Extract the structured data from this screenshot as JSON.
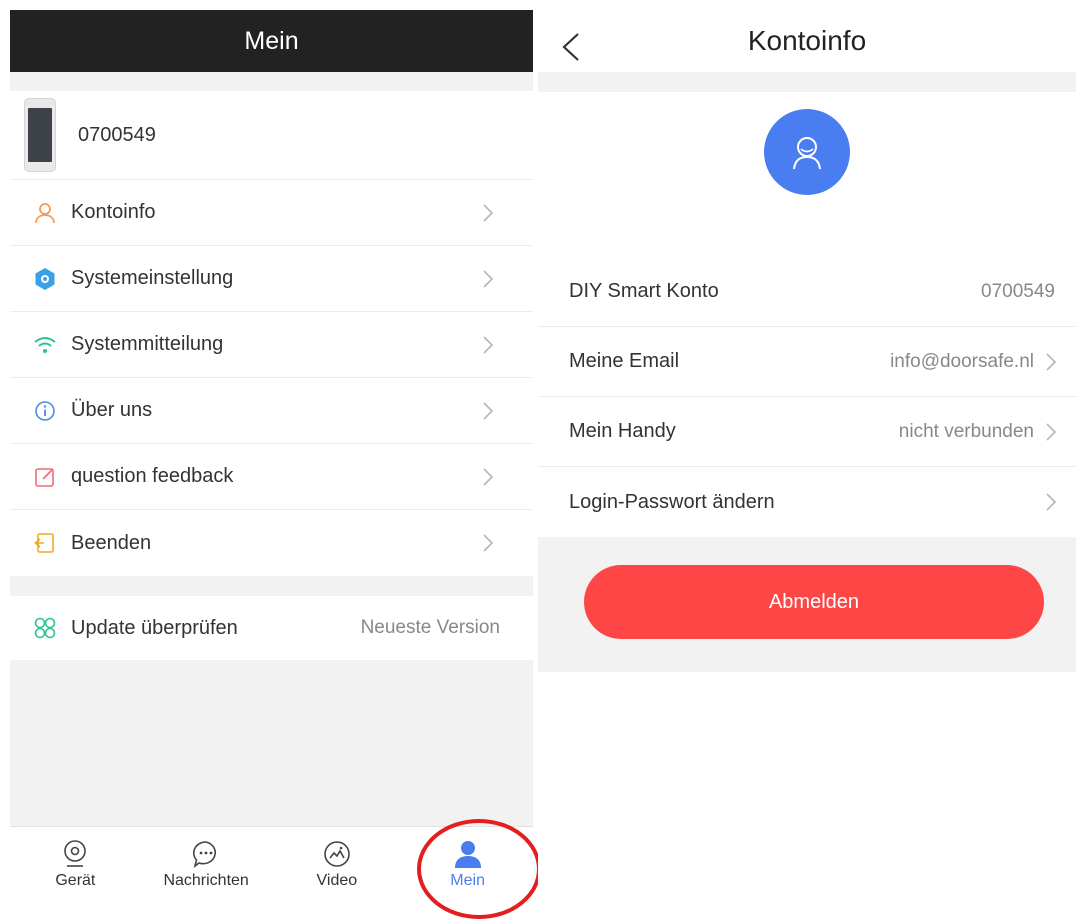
{
  "left": {
    "title": "Mein",
    "device": {
      "name": "0700549"
    },
    "menu": [
      {
        "label": "Kontoinfo",
        "icon": "user-icon"
      },
      {
        "label": "Systemeinstellung",
        "icon": "settings-icon"
      },
      {
        "label": "Systemmitteilung",
        "icon": "wifi-icon"
      },
      {
        "label": "Über uns",
        "icon": "info-icon"
      },
      {
        "label": "question feedback",
        "icon": "edit-icon"
      },
      {
        "label": "Beenden",
        "icon": "exit-icon"
      }
    ],
    "update": {
      "label": "Update überprüfen",
      "value": "Neueste Version",
      "icon": "update-icon"
    },
    "tabs": [
      {
        "label": "Gerät",
        "icon": "camera-icon"
      },
      {
        "label": "Nachrichten",
        "icon": "message-icon"
      },
      {
        "label": "Video",
        "icon": "video-icon"
      },
      {
        "label": "Mein",
        "icon": "person-icon",
        "active": true
      }
    ]
  },
  "right": {
    "title": "Kontoinfo",
    "rows": [
      {
        "label": "DIY Smart Konto",
        "value": "0700549"
      },
      {
        "label": "Meine Email",
        "value": "info@doorsafe.nl"
      },
      {
        "label": "Mein Handy",
        "value": "nicht verbunden"
      },
      {
        "label": "Login-Passwort ändern",
        "value": ""
      }
    ],
    "signout_label": "Abmelden"
  },
  "colors": {
    "header_dark": "#222222",
    "accent_blue": "#4a7ef0",
    "signout_red": "#fe4646",
    "annotation_red": "#e41e1e"
  }
}
